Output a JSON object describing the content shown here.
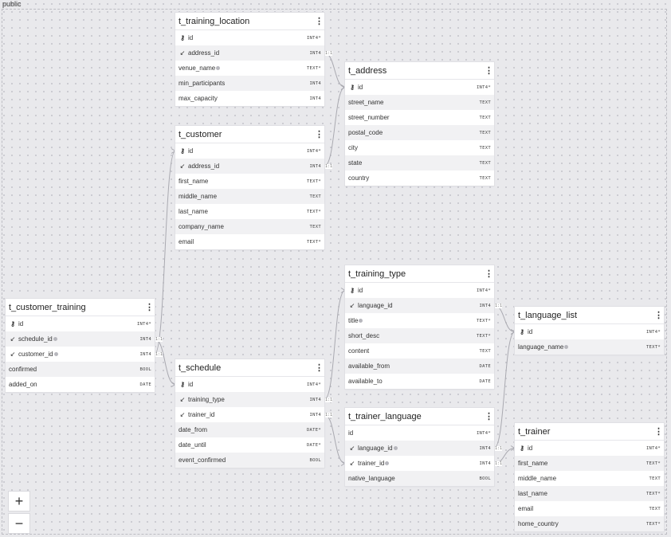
{
  "schema": {
    "label": "public"
  },
  "type_badges": {
    "int_pk": "INT4*",
    "int": "INT4",
    "text": "TEXT",
    "text_req": "TEXT*",
    "bool": "BOOL",
    "date": "DATE",
    "date_req": "DATE*"
  },
  "cardinality": "1:1",
  "tables": {
    "t_training_location": {
      "name": "t_training_location",
      "columns": [
        {
          "name": "id",
          "type": "INT4*",
          "icon": "key"
        },
        {
          "name": "address_id",
          "type": "INT4",
          "icon": "fk"
        },
        {
          "name": "venue_name",
          "type": "TEXT*",
          "icon": "",
          "note": true
        },
        {
          "name": "min_participants",
          "type": "INT4",
          "icon": ""
        },
        {
          "name": "max_capacity",
          "type": "INT4",
          "icon": ""
        }
      ]
    },
    "t_address": {
      "name": "t_address",
      "columns": [
        {
          "name": "id",
          "type": "INT4*",
          "icon": "key"
        },
        {
          "name": "street_name",
          "type": "TEXT",
          "icon": ""
        },
        {
          "name": "street_number",
          "type": "TEXT",
          "icon": ""
        },
        {
          "name": "postal_code",
          "type": "TEXT",
          "icon": ""
        },
        {
          "name": "city",
          "type": "TEXT",
          "icon": ""
        },
        {
          "name": "state",
          "type": "TEXT",
          "icon": ""
        },
        {
          "name": "country",
          "type": "TEXT",
          "icon": ""
        }
      ]
    },
    "t_customer": {
      "name": "t_customer",
      "columns": [
        {
          "name": "id",
          "type": "INT4*",
          "icon": "key"
        },
        {
          "name": "address_id",
          "type": "INT4",
          "icon": "fk"
        },
        {
          "name": "first_name",
          "type": "TEXT*",
          "icon": ""
        },
        {
          "name": "middle_name",
          "type": "TEXT",
          "icon": ""
        },
        {
          "name": "last_name",
          "type": "TEXT*",
          "icon": ""
        },
        {
          "name": "company_name",
          "type": "TEXT",
          "icon": ""
        },
        {
          "name": "email",
          "type": "TEXT*",
          "icon": ""
        }
      ]
    },
    "t_customer_training": {
      "name": "t_customer_training",
      "columns": [
        {
          "name": "id",
          "type": "INT4*",
          "icon": "key"
        },
        {
          "name": "schedule_id",
          "type": "INT4",
          "icon": "fk",
          "note": true
        },
        {
          "name": "customer_id",
          "type": "INT4",
          "icon": "fk",
          "note": true
        },
        {
          "name": "confirmed",
          "type": "BOOL",
          "icon": ""
        },
        {
          "name": "added_on",
          "type": "DATE",
          "icon": ""
        }
      ]
    },
    "t_schedule": {
      "name": "t_schedule",
      "columns": [
        {
          "name": "id",
          "type": "INT4*",
          "icon": "key"
        },
        {
          "name": "training_type",
          "type": "INT4",
          "icon": "fk"
        },
        {
          "name": "trainer_id",
          "type": "INT4",
          "icon": "fk"
        },
        {
          "name": "date_from",
          "type": "DATE*",
          "icon": ""
        },
        {
          "name": "date_until",
          "type": "DATE*",
          "icon": ""
        },
        {
          "name": "event_confirmed",
          "type": "BOOL",
          "icon": ""
        }
      ]
    },
    "t_training_type": {
      "name": "t_training_type",
      "columns": [
        {
          "name": "id",
          "type": "INT4*",
          "icon": "key"
        },
        {
          "name": "language_id",
          "type": "INT4",
          "icon": "fk"
        },
        {
          "name": "title",
          "type": "TEXT*",
          "icon": "",
          "note": true
        },
        {
          "name": "short_desc",
          "type": "TEXT*",
          "icon": ""
        },
        {
          "name": "content",
          "type": "TEXT",
          "icon": ""
        },
        {
          "name": "available_from",
          "type": "DATE",
          "icon": ""
        },
        {
          "name": "available_to",
          "type": "DATE",
          "icon": ""
        }
      ]
    },
    "t_trainer_language": {
      "name": "t_trainer_language",
      "columns": [
        {
          "name": "id",
          "type": "INT4*",
          "icon": ""
        },
        {
          "name": "language_id",
          "type": "INT4",
          "icon": "fk",
          "note": true
        },
        {
          "name": "trainer_id",
          "type": "INT4",
          "icon": "fk",
          "note": true
        },
        {
          "name": "native_language",
          "type": "BOOL",
          "icon": ""
        }
      ]
    },
    "t_language_list": {
      "name": "t_language_list",
      "columns": [
        {
          "name": "id",
          "type": "INT4*",
          "icon": "key"
        },
        {
          "name": "language_name",
          "type": "TEXT*",
          "icon": "",
          "note": true
        }
      ]
    },
    "t_trainer": {
      "name": "t_trainer",
      "columns": [
        {
          "name": "id",
          "type": "INT4*",
          "icon": "key"
        },
        {
          "name": "first_name",
          "type": "TEXT*",
          "icon": ""
        },
        {
          "name": "middle_name",
          "type": "TEXT",
          "icon": ""
        },
        {
          "name": "last_name",
          "type": "TEXT*",
          "icon": ""
        },
        {
          "name": "email",
          "type": "TEXT",
          "icon": ""
        },
        {
          "name": "home_country",
          "type": "TEXT*",
          "icon": ""
        }
      ]
    }
  },
  "zoom": {
    "in_label": "+",
    "out_label": "−"
  },
  "icons": {
    "key": "key-icon",
    "fk": "foreign-key-arrow-icon",
    "menu": "kebab-menu-icon"
  }
}
